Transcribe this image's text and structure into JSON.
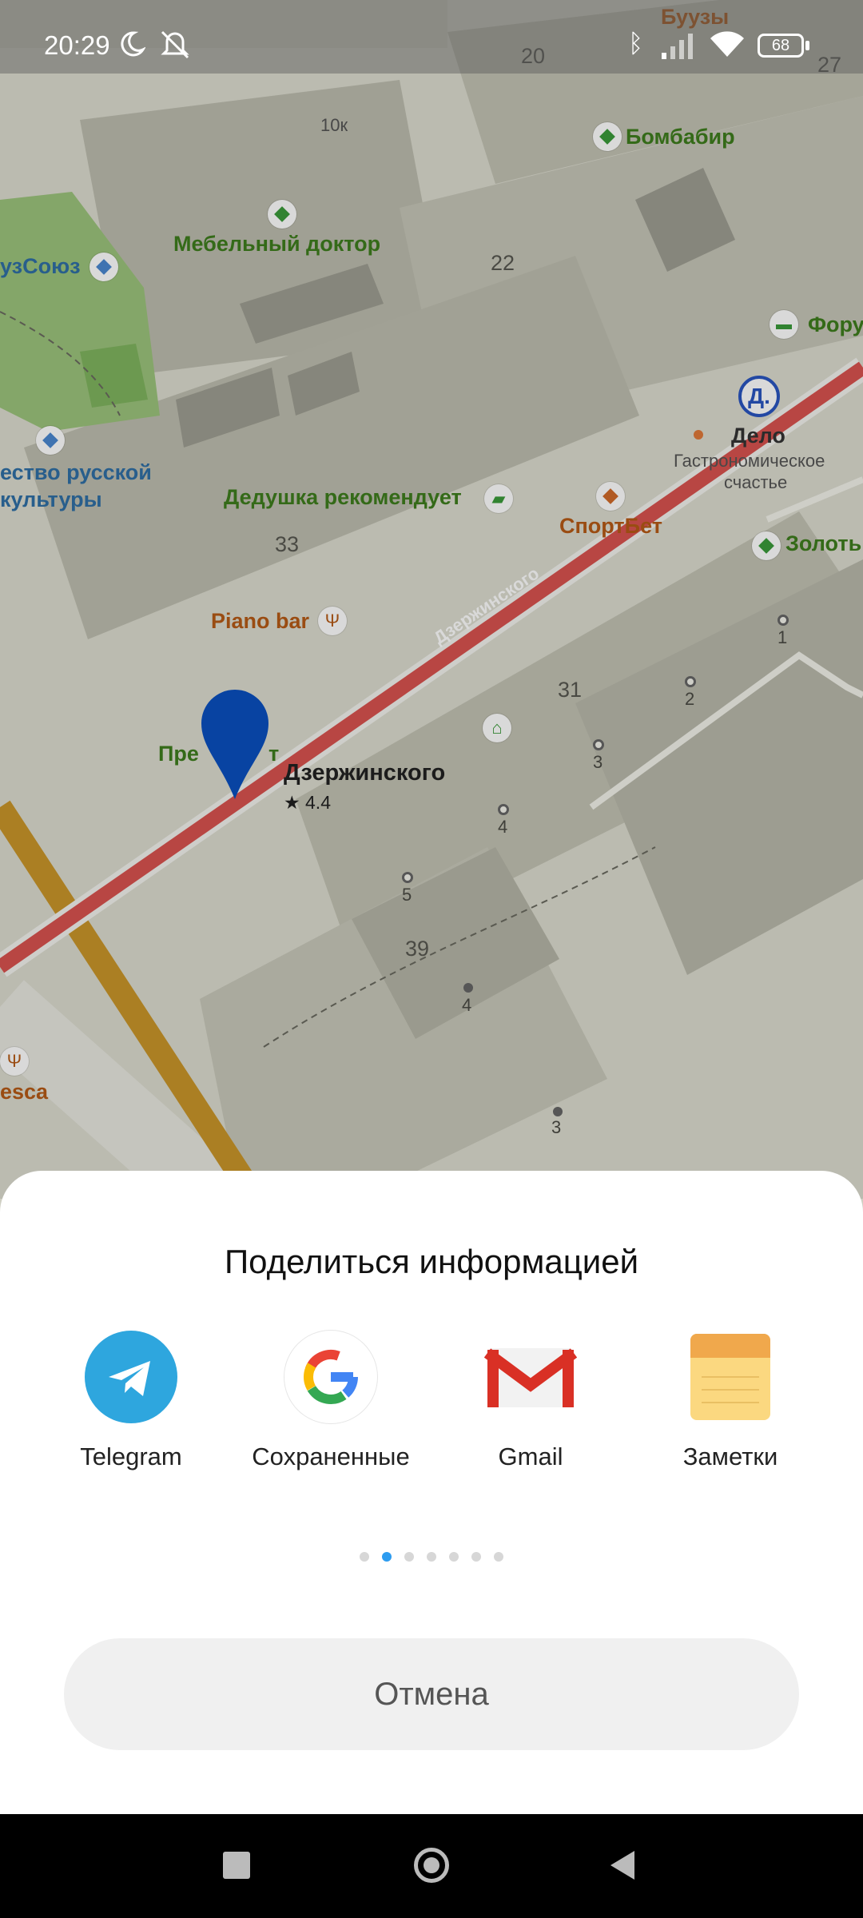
{
  "status_bar": {
    "time": "20:29",
    "battery": "68"
  },
  "map": {
    "buildings": [
      "20",
      "27",
      "22",
      "33",
      "31",
      "39"
    ],
    "house_numbers": [
      "1",
      "2",
      "3",
      "4",
      "5",
      "4",
      "3"
    ],
    "places": {
      "buuzy": "Буузы",
      "bombabir": "Бомбабир",
      "mebelny": "Мебельный доктор",
      "soyuz": "узСоюз",
      "russian_culture_1": "ество русской",
      "russian_culture_2": "культуры",
      "dedushka": "Дедушка рекомендует",
      "sportbet": "СпортБет",
      "delo": "Дело",
      "delo_sub_1": "Гастрономическое",
      "delo_sub_2": "счастье",
      "zoloto": "Золоть",
      "foru": "Фору",
      "piano": "Piano bar",
      "prez_a": "Пре",
      "prez_b": "т",
      "esca": "esca",
      "small": "10к"
    },
    "street": "Дзержинского",
    "selected_place": {
      "name": "Дзержинского",
      "rating": "★ 4.4"
    }
  },
  "share_sheet": {
    "title": "Поделиться информацией",
    "apps": [
      {
        "name": "Telegram"
      },
      {
        "name": "Сохраненные"
      },
      {
        "name": "Gmail"
      },
      {
        "name": "Заметки"
      }
    ],
    "pages": 7,
    "active_page": 2,
    "cancel_label": "Отмена"
  },
  "colors": {
    "accent": "#2d9cf0",
    "road": "#d9534f",
    "highway": "#c9962a",
    "pin": "#0a4fbf"
  }
}
